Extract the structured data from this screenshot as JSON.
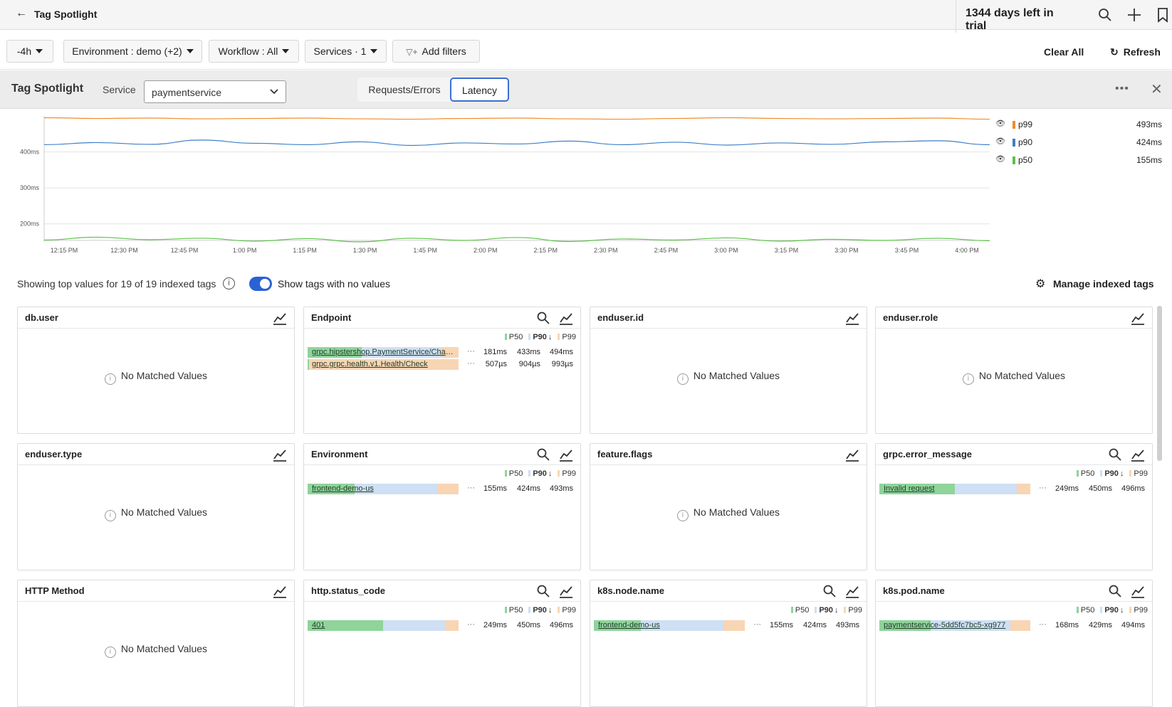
{
  "topbar": {
    "title": "Tag Spotlight",
    "trial": "1344 days left in trial"
  },
  "filters": {
    "time": "-4h",
    "environment": "Environment : demo (+2)",
    "workflow": "Workflow : All",
    "services": "Services · 1",
    "add_filters": "Add filters",
    "clear_all": "Clear All",
    "refresh": "Refresh"
  },
  "spotlight": {
    "title": "Tag Spotlight",
    "service_label": "Service",
    "service_value": "paymentservice",
    "tabs": [
      {
        "label": "Requests/Errors",
        "active": false
      },
      {
        "label": "Latency",
        "active": true
      }
    ]
  },
  "chart_data": {
    "type": "line",
    "x": [
      "12:15 PM",
      "12:30 PM",
      "12:45 PM",
      "1:00 PM",
      "1:15 PM",
      "1:30 PM",
      "1:45 PM",
      "2:00 PM",
      "2:15 PM",
      "2:30 PM",
      "2:45 PM",
      "3:00 PM",
      "3:15 PM",
      "3:30 PM",
      "3:45 PM",
      "4:00 PM"
    ],
    "ylabel_ticks": [
      "400ms",
      "300ms",
      "200ms"
    ],
    "y_ticks": [
      400,
      300,
      200
    ],
    "ylim": [
      150,
      500
    ],
    "grid": true,
    "legend_position": "right",
    "series": [
      {
        "name": "p99",
        "color": "#f08c2c",
        "summary": "493ms",
        "values": [
          495,
          493,
          494,
          492,
          493,
          494,
          492,
          491,
          493,
          494,
          492,
          491,
          493,
          495,
          493,
          492,
          493,
          494,
          491
        ]
      },
      {
        "name": "p90",
        "color": "#3f7fc8",
        "summary": "424ms",
        "values": [
          420,
          426,
          421,
          433,
          424,
          420,
          428,
          418,
          425,
          422,
          430,
          420,
          427,
          419,
          425,
          421,
          428,
          431,
          420
        ]
      },
      {
        "name": "p50",
        "color": "#5cc24a",
        "summary": "155ms",
        "values": [
          155,
          163,
          156,
          160,
          152,
          159,
          150,
          160,
          154,
          162,
          151,
          158,
          155,
          161,
          152,
          157,
          154,
          160,
          153
        ]
      }
    ]
  },
  "infobar": {
    "showing": "Showing top values for 19 of 19 indexed tags",
    "toggle_label": "Show tags with no values",
    "manage": "Manage indexed tags"
  },
  "legend_labels": {
    "p50": "P50",
    "p90": "P90",
    "p99": "P99",
    "sort": "↓"
  },
  "cards": [
    {
      "title": "db.user",
      "search": false,
      "empty": true,
      "empty_text": "No Matched Values"
    },
    {
      "title": "Endpoint",
      "search": true,
      "empty": false,
      "rows": [
        {
          "label": "grpc.hipstershop.PaymentService/Charge",
          "p50": "181ms",
          "p90": "433ms",
          "p99": "494ms",
          "f50": 0.36,
          "f90": 0.88
        },
        {
          "label": "grpc.grpc.health.v1.Health/Check",
          "p50": "507µs",
          "p90": "904µs",
          "p99": "993µs",
          "f50": 0.005,
          "f90": 0.01
        }
      ]
    },
    {
      "title": "enduser.id",
      "search": false,
      "empty": true,
      "empty_text": "No Matched Values"
    },
    {
      "title": "enduser.role",
      "search": false,
      "empty": true,
      "empty_text": "No Matched Values"
    },
    {
      "title": "enduser.type",
      "search": false,
      "empty": true,
      "empty_text": "No Matched Values"
    },
    {
      "title": "Environment",
      "search": true,
      "empty": false,
      "rows": [
        {
          "label": "frontend-demo-us",
          "p50": "155ms",
          "p90": "424ms",
          "p99": "493ms",
          "f50": 0.31,
          "f90": 0.86
        }
      ]
    },
    {
      "title": "feature.flags",
      "search": false,
      "empty": true,
      "empty_text": "No Matched Values"
    },
    {
      "title": "grpc.error_message",
      "search": true,
      "empty": false,
      "rows": [
        {
          "label": "Invalid request",
          "p50": "249ms",
          "p90": "450ms",
          "p99": "496ms",
          "f50": 0.5,
          "f90": 0.91
        }
      ]
    },
    {
      "title": "HTTP Method",
      "search": false,
      "empty": true,
      "empty_text": "No Matched Values"
    },
    {
      "title": "http.status_code",
      "search": true,
      "empty": false,
      "rows": [
        {
          "label": "401",
          "p50": "249ms",
          "p90": "450ms",
          "p99": "496ms",
          "f50": 0.5,
          "f90": 0.91
        }
      ]
    },
    {
      "title": "k8s.node.name",
      "search": true,
      "empty": false,
      "rows": [
        {
          "label": "frontend-demo-us",
          "p50": "155ms",
          "p90": "424ms",
          "p99": "493ms",
          "f50": 0.31,
          "f90": 0.86
        }
      ]
    },
    {
      "title": "k8s.pod.name",
      "search": true,
      "empty": false,
      "rows": [
        {
          "label": "paymentservice-5dd5fc7bc5-xg977",
          "p50": "168ms",
          "p90": "429ms",
          "p99": "494ms",
          "f50": 0.34,
          "f90": 0.87
        }
      ]
    }
  ]
}
